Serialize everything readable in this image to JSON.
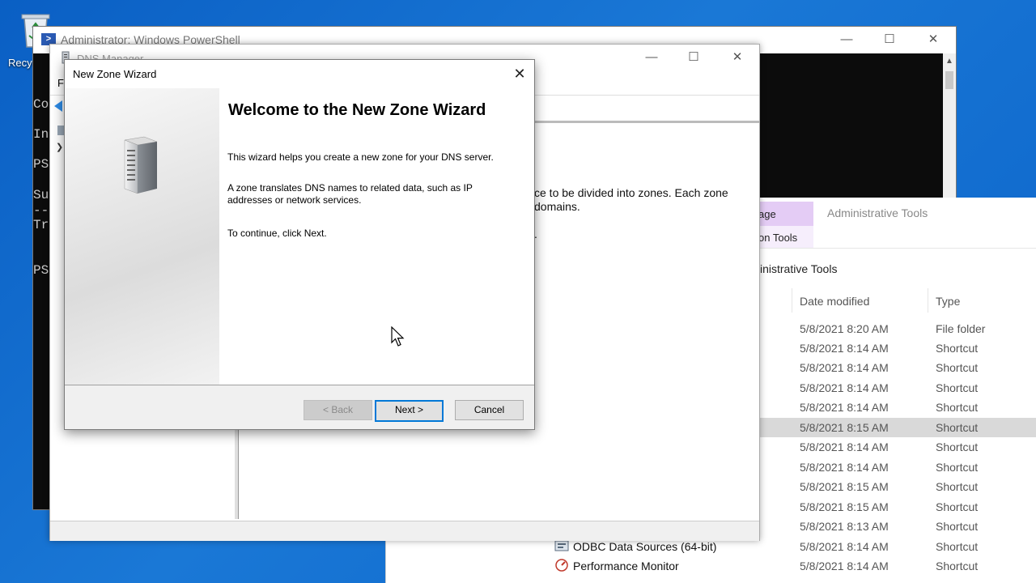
{
  "desktop": {
    "recycle_bin_label": "RecycleWi"
  },
  "powershell": {
    "title": "Administrator: Windows PowerShell",
    "console_lines": [
      "Co",
      "In",
      "PS",
      "Su",
      "--",
      "Tr",
      "PS"
    ],
    "buttons": {
      "minimize": "—",
      "maximize": "☐",
      "close": "✕"
    }
  },
  "dns_manager": {
    "title": "DNS Manager",
    "menu_fragment": "F",
    "buttons": {
      "minimize": "—",
      "maximize": "☐",
      "close": "✕"
    },
    "description_line1": "ce to be divided into zones. Each zone",
    "description_line2": "domains.",
    "description_end": "."
  },
  "wizard": {
    "title": "New Zone Wizard",
    "close": "✕",
    "heading": "Welcome to the New Zone Wizard",
    "paragraph1": "This wizard helps you create a new zone for your DNS server.",
    "paragraph2": "A zone translates DNS names to related data, such as IP addresses or network services.",
    "paragraph3": "To continue, click Next.",
    "back_button": "< Back",
    "next_button": "Next >",
    "cancel_button": "Cancel"
  },
  "explorer": {
    "tab_manage": "age",
    "tab_app_tools": "on Tools",
    "tab_admin_tools": "Administrative Tools",
    "address": "inistrative Tools",
    "columns": {
      "date": "Date modified",
      "type": "Type"
    },
    "rows": [
      {
        "date": "5/8/2021 8:20 AM",
        "type": "File folder"
      },
      {
        "date": "5/8/2021 8:14 AM",
        "type": "Shortcut"
      },
      {
        "date": "5/8/2021 8:14 AM",
        "type": "Shortcut"
      },
      {
        "date": "5/8/2021 8:14 AM",
        "type": "Shortcut"
      },
      {
        "date": "5/8/2021 8:14 AM",
        "type": "Shortcut"
      },
      {
        "date": "5/8/2021 8:15 AM",
        "type": "Shortcut"
      },
      {
        "date": "5/8/2021 8:14 AM",
        "type": "Shortcut"
      },
      {
        "date": "5/8/2021 8:14 AM",
        "type": "Shortcut"
      },
      {
        "date": "5/8/2021 8:15 AM",
        "type": "Shortcut"
      },
      {
        "date": "5/8/2021 8:15 AM",
        "type": "Shortcut"
      },
      {
        "date": "5/8/2021 8:13 AM",
        "type": "Shortcut"
      },
      {
        "date": "5/8/2021 8:14 AM",
        "type": "Shortcut"
      },
      {
        "date": "5/8/2021 8:14 AM",
        "type": "Shortcut"
      }
    ],
    "visible_names": [
      "ODBC Data Sources (64-bit)",
      "Performance Monitor"
    ]
  }
}
